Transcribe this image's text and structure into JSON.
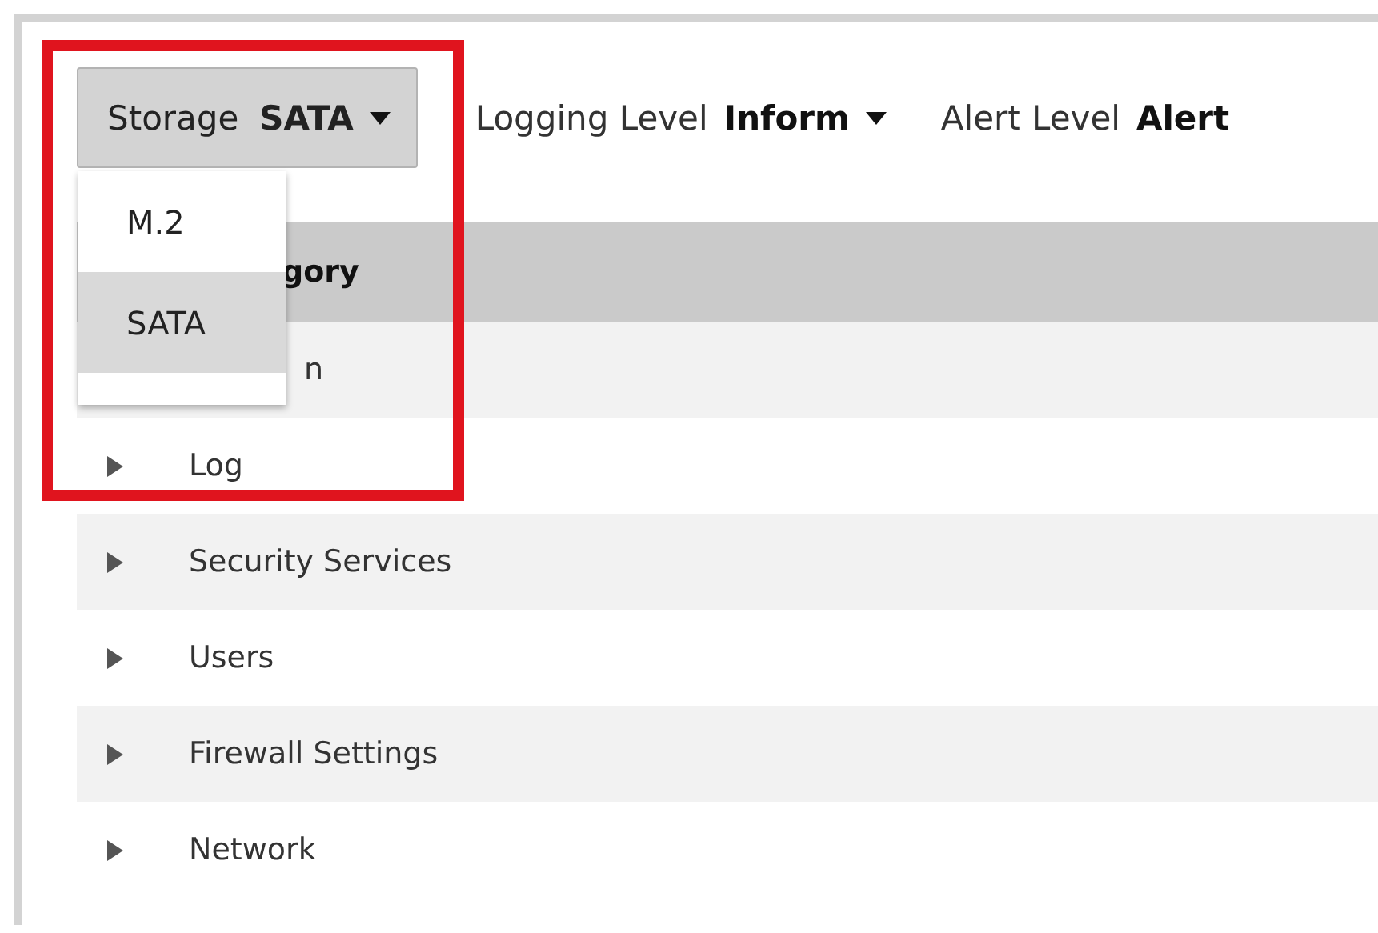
{
  "toolbar": {
    "storage": {
      "label": "Storage",
      "value": "SATA",
      "expanded": true,
      "options": [
        {
          "label": "M.2",
          "selected": false
        },
        {
          "label": "SATA",
          "selected": true
        }
      ]
    },
    "logging": {
      "label": "Logging Level",
      "value": "Inform"
    },
    "alert": {
      "label": "Alert Level",
      "value": "Alert"
    }
  },
  "table": {
    "header": "gory",
    "rows": [
      {
        "kind": "partial",
        "label": "n"
      },
      {
        "kind": "item",
        "label": "Log"
      },
      {
        "kind": "item",
        "label": "Security Services"
      },
      {
        "kind": "item",
        "label": "Users"
      },
      {
        "kind": "item",
        "label": "Firewall Settings"
      },
      {
        "kind": "item",
        "label": "Network"
      }
    ]
  },
  "highlight": {
    "on": true
  }
}
